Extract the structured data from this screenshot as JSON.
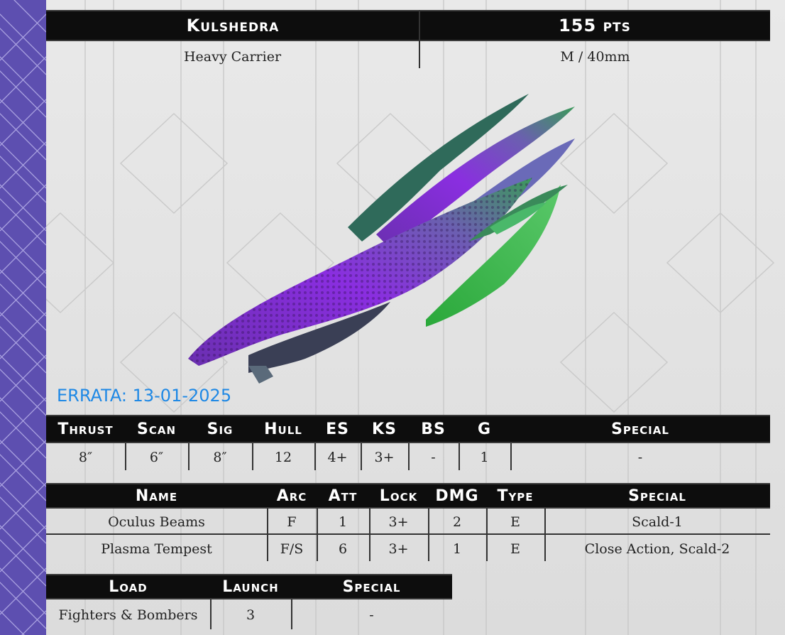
{
  "header": {
    "ship_name": "Kulshedra",
    "points": "155 pts",
    "ship_class": "Heavy Carrier",
    "size": "M / 40mm"
  },
  "errata": "ERRATA: 13-01-2025",
  "image": {
    "icon": "ship-illustration"
  },
  "stats": {
    "headers": [
      "Thrust",
      "Scan",
      "Sig",
      "Hull",
      "ES",
      "KS",
      "BS",
      "G",
      "Special"
    ],
    "values": [
      "8″",
      "6″",
      "8″",
      "12",
      "4+",
      "3+",
      "-",
      "1",
      "-"
    ]
  },
  "weapons": {
    "headers": [
      "Name",
      "Arc",
      "Att",
      "Lock",
      "DMG",
      "Type",
      "Special"
    ],
    "rows": [
      [
        "Oculus Beams",
        "F",
        "1",
        "3+",
        "2",
        "E",
        "Scald-1"
      ],
      [
        "Plasma Tempest",
        "F/S",
        "6",
        "3+",
        "1",
        "E",
        "Close Action, Scald-2"
      ]
    ]
  },
  "launch": {
    "headers": [
      "Load",
      "Launch",
      "Special"
    ],
    "rows": [
      [
        "Fighters & Bombers",
        "3",
        "-"
      ]
    ]
  },
  "colors": {
    "band": "#5d4fb0",
    "errata": "#1e88e5",
    "bar": "#0d0d0d"
  }
}
